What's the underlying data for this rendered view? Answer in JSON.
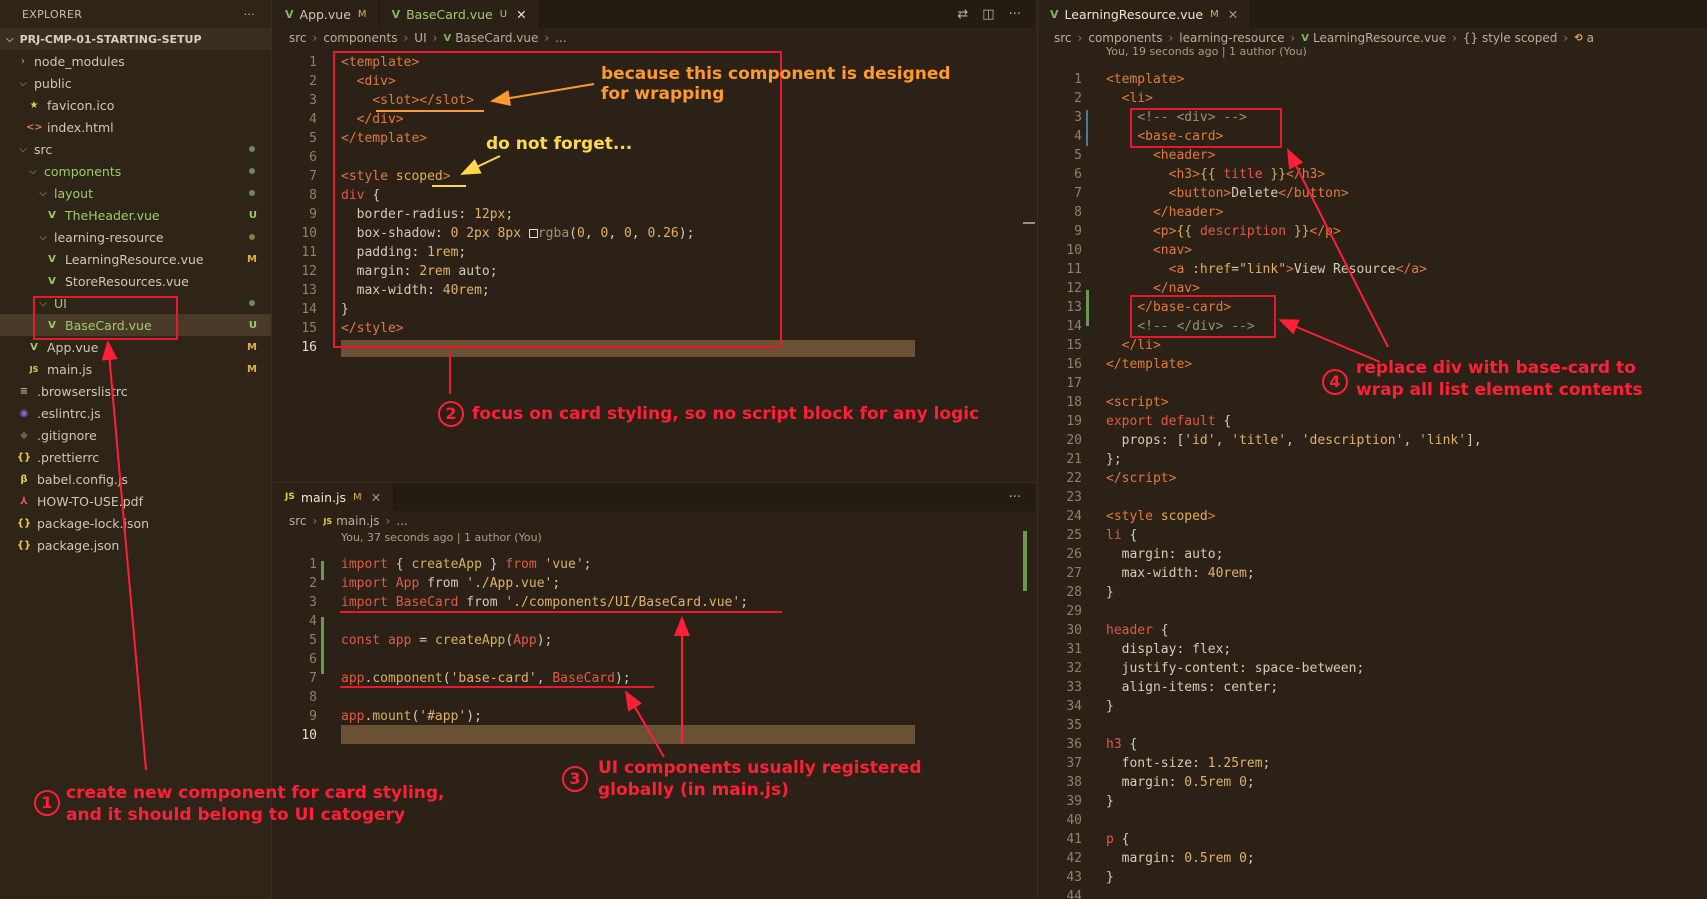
{
  "sidebar": {
    "title": "EXPLORER",
    "more": "···",
    "project": "PRJ-CMP-01-STARTING-SETUP",
    "items": [
      {
        "label": "node_modules"
      },
      {
        "label": "public"
      },
      {
        "label": "favicon.ico"
      },
      {
        "label": "index.html"
      },
      {
        "label": "src"
      },
      {
        "label": "components"
      },
      {
        "label": "layout"
      },
      {
        "label": "TheHeader.vue",
        "badge": "U"
      },
      {
        "label": "learning-resource"
      },
      {
        "label": "LearningResource.vue",
        "badge": "M"
      },
      {
        "label": "StoreResources.vue"
      },
      {
        "label": "UI"
      },
      {
        "label": "BaseCard.vue",
        "badge": "U"
      },
      {
        "label": "App.vue",
        "badge": "M"
      },
      {
        "label": "main.js",
        "badge": "M"
      },
      {
        "label": ".browserslistrc"
      },
      {
        "label": ".eslintrc.js"
      },
      {
        "label": ".gitignore"
      },
      {
        "label": ".prettierrc"
      },
      {
        "label": "babel.config.js"
      },
      {
        "label": "HOW-TO-USE.pdf"
      },
      {
        "label": "package-lock.json"
      },
      {
        "label": "package.json"
      }
    ]
  },
  "editor_top": {
    "tabs": [
      {
        "label": "App.vue",
        "status": "M"
      },
      {
        "label": "BaseCard.vue",
        "status": "U",
        "close": "✕"
      }
    ],
    "breadcrumb": [
      "src",
      "components",
      "UI",
      "BaseCard.vue",
      "..."
    ],
    "lines": [
      {
        "n": "1"
      },
      {
        "n": "2"
      },
      {
        "n": "3"
      },
      {
        "n": "4"
      },
      {
        "n": "5"
      },
      {
        "n": "6"
      },
      {
        "n": "7"
      },
      {
        "n": "8"
      },
      {
        "n": "9"
      },
      {
        "n": "10"
      },
      {
        "n": "11"
      },
      {
        "n": "12"
      },
      {
        "n": "13"
      },
      {
        "n": "14"
      },
      {
        "n": "15"
      },
      {
        "n": "16"
      }
    ]
  },
  "editor_bottom": {
    "tabs": [
      {
        "label": "main.js",
        "status": "M",
        "close": "✕"
      }
    ],
    "more": "···",
    "breadcrumb": [
      "src",
      "main.js",
      "..."
    ],
    "blame": "You, 37 seconds ago | 1 author (You)",
    "lines": [
      {
        "n": "1"
      },
      {
        "n": "2"
      },
      {
        "n": "3"
      },
      {
        "n": "4"
      },
      {
        "n": "5"
      },
      {
        "n": "6"
      },
      {
        "n": "7"
      },
      {
        "n": "8"
      },
      {
        "n": "9"
      },
      {
        "n": "10"
      }
    ]
  },
  "editor_right": {
    "tabs": [
      {
        "label": "LearningResource.vue",
        "status": "M",
        "close": "✕"
      }
    ],
    "breadcrumb": [
      "src",
      "components",
      "learning-resource",
      "LearningResource.vue",
      "{} style scoped",
      "a"
    ],
    "blame": "You, 19 seconds ago | 1 author (You)"
  },
  "annotations": {
    "wrapping_1": "because this component is designed",
    "wrapping_2": "for wrapping",
    "forget": "do not forget...",
    "n1": "1",
    "note1_1": "create new component for card styling,",
    "note1_2": "and it should belong to UI catogery",
    "n2": "2",
    "note2": "focus on card styling, so no script block for any logic",
    "n3": "3",
    "note3_1": "UI components usually registered",
    "note3_2": "globally (in main.js)",
    "n4": "4",
    "note4_1": "replace div with base-card to",
    "note4_2": "wrap all list element contents"
  }
}
